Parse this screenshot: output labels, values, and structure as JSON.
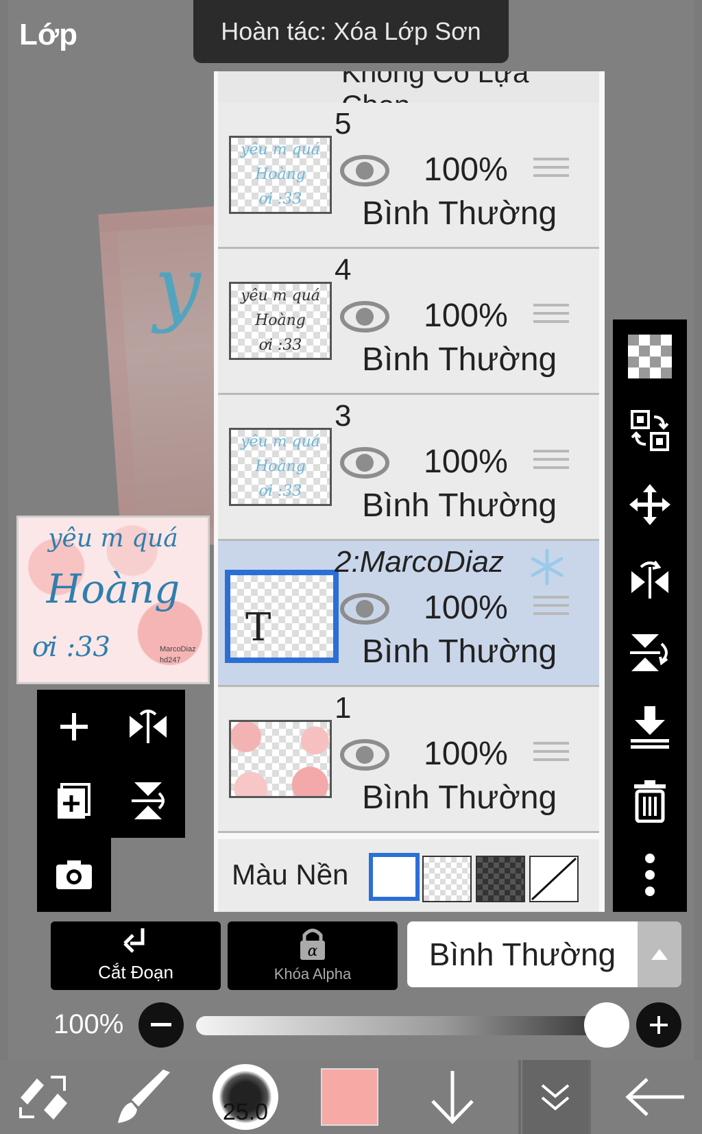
{
  "panel": {
    "title": "Lớp"
  },
  "toast": {
    "text": "Hoàn tác: Xóa Lớp Sơn"
  },
  "layers_list": {
    "no_selection_label": "Không Có Lựa Chọn",
    "layers": [
      {
        "name": "5",
        "opacity": "100%",
        "blend": "Bình Thường",
        "thumb_text": [
          "yêu m quá",
          "Hoàng",
          "ơi :33"
        ],
        "selected": false
      },
      {
        "name": "4",
        "opacity": "100%",
        "blend": "Bình Thường",
        "thumb_text": [
          "yêu m quá",
          "Hoàng",
          "ơi :33"
        ],
        "selected": false
      },
      {
        "name": "3",
        "opacity": "100%",
        "blend": "Bình Thường",
        "thumb_text": [
          "yêu m quá",
          "Hoàng",
          "ơi :33"
        ],
        "selected": false
      },
      {
        "name": "2:MarcoDiaz",
        "opacity": "100%",
        "blend": "Bình Thường",
        "thumb_text": [
          "T"
        ],
        "selected": true,
        "badge_icon": "snowflake-icon"
      },
      {
        "name": "1",
        "opacity": "100%",
        "blend": "Bình Thường",
        "thumb_text": [],
        "selected": false
      }
    ],
    "background_color": {
      "label": "Màu Nền",
      "selected": "white"
    }
  },
  "preview": {
    "line1": "yêu m quá",
    "line2": "Hoàng",
    "line3": "ơi :33",
    "sig1": "MarcoDiaz",
    "sig2": "hd247"
  },
  "left_tools": [
    "add-layer-icon",
    "flip-horizontal-icon",
    "duplicate-layer-icon",
    "flip-vertical-icon",
    "camera-icon"
  ],
  "right_tools": [
    "transparency-icon",
    "swap-icon",
    "move-icon",
    "flip-h-icon",
    "flip-v-icon",
    "merge-down-icon",
    "trash-icon",
    "more-icon"
  ],
  "bottom_controls": {
    "clip_label": "Cắt Đoạn",
    "alpha_lock_label": "Khóa Alpha",
    "blend_mode": "Bình Thường",
    "opacity_label": "100%",
    "opacity_value": 1.0
  },
  "appbar": {
    "brush_size": "25.0",
    "color": "#f7a9a6"
  }
}
